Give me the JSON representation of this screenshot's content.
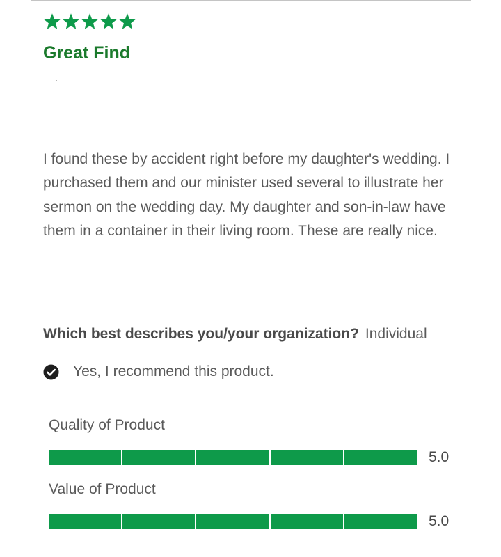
{
  "review": {
    "rating": 5,
    "max_rating": 5,
    "star_icon": "star-icon",
    "star_color": "#0e9a4a",
    "title": "Great Find",
    "title_color": "#1b7a2c",
    "body": "I found these by accident right before my daughter's wedding. I purchased them and our minister used several to illustrate her sermon on the wedding day. My daughter and son-in-law have them in a container in their living room. These are really nice.",
    "describes": {
      "label": "Which best describes you/your organization?",
      "value": "Individual"
    },
    "recommend": {
      "icon": "check-circle-icon",
      "text": "Yes, I recommend this product."
    },
    "secondary_ratings": [
      {
        "label": "Quality of Product",
        "value": 5.0,
        "max": 5,
        "display": "5.0"
      },
      {
        "label": "Value of Product",
        "value": 5.0,
        "max": 5,
        "display": "5.0"
      }
    ],
    "bar_color": "#0e9a4a"
  }
}
